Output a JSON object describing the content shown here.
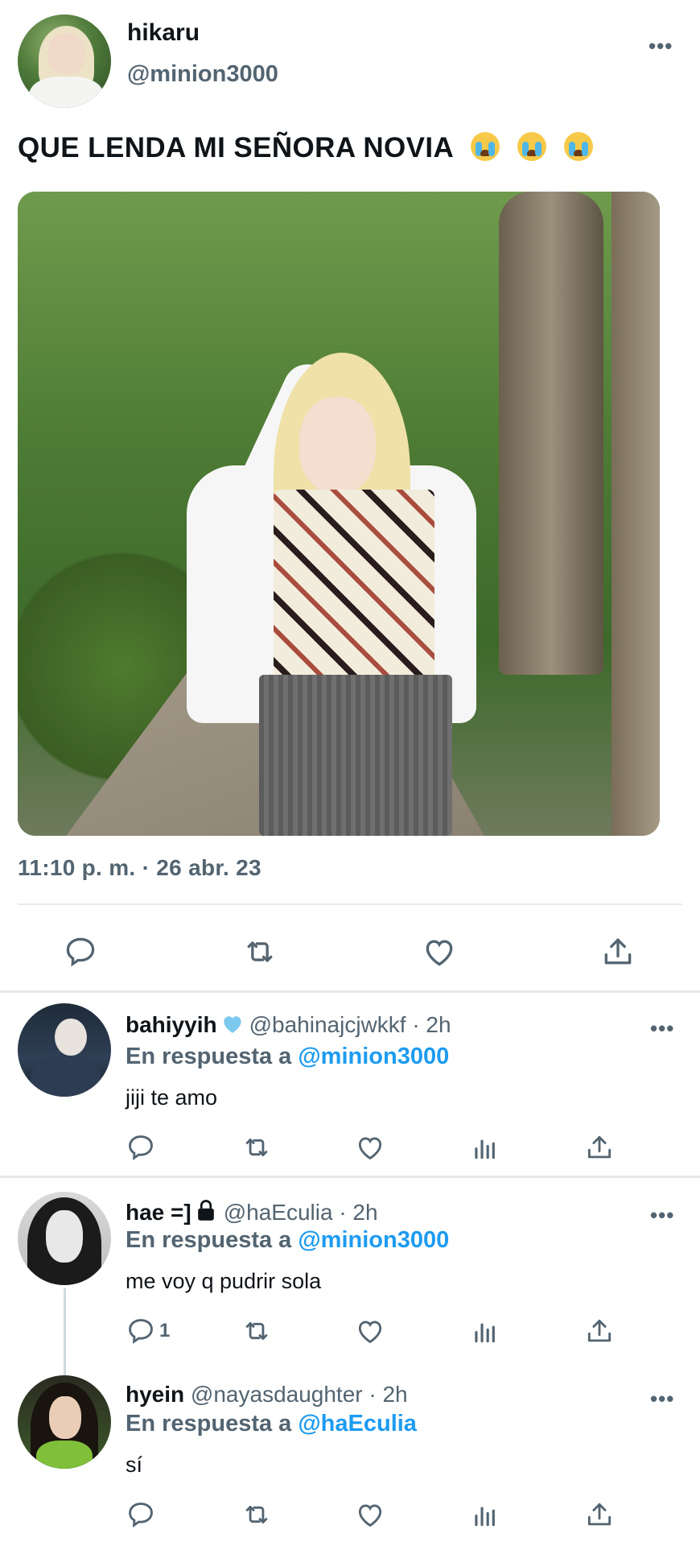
{
  "main_tweet": {
    "name": "hikaru",
    "handle": "@minion3000",
    "text": "QUE LENDA MI SEÑORA NOVIA",
    "emojis": [
      "loudly-crying-face",
      "loudly-crying-face",
      "loudly-crying-face"
    ],
    "timestamp": "11:10 p. m. · 26 abr. 23",
    "more_label": "•••",
    "actions": [
      "reply-icon",
      "retweet-icon",
      "like-icon",
      "share-icon"
    ]
  },
  "replies": [
    {
      "name": "bahiyyih",
      "badge": "verified-badge",
      "handle_time": "@bahinajcjwkkf · 2h",
      "reply_prefix": "En respuesta a",
      "reply_to": "@minion3000",
      "text": "jiji te amo",
      "reply_count": "",
      "more_label": "•••"
    },
    {
      "name": "hae =]",
      "badge": "lock-icon",
      "handle_time": "@haEculia · 2h",
      "reply_prefix": "En respuesta a",
      "reply_to": "@minion3000",
      "text": "me voy q pudrir sola",
      "reply_count": "1",
      "more_label": "•••"
    },
    {
      "name": "hyein",
      "handle_time": "@nayasdaughter · 2h",
      "reply_prefix": "En respuesta a",
      "reply_to": "@haEculia",
      "text": "sí",
      "reply_count": "",
      "more_label": "•••"
    }
  ],
  "colors": {
    "text_primary": "#0f1419",
    "text_secondary": "#536471",
    "mention": "#1d9bf0",
    "divider": "#e8ebed"
  }
}
